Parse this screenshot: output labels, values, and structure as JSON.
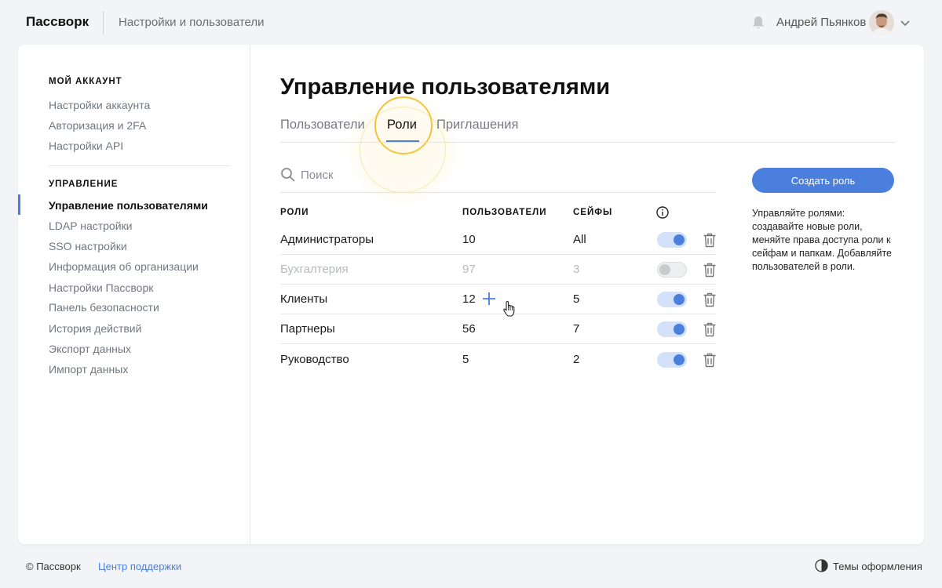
{
  "header": {
    "brand": "Пассворк",
    "breadcrumb": "Настройки и пользователи",
    "user_name": "Андрей Пьянков"
  },
  "sidebar": {
    "account_section": {
      "title": "МОЙ АККАУНТ",
      "items": [
        "Настройки аккаунта",
        "Авторизация и 2FA",
        "Настройки API"
      ]
    },
    "manage_section": {
      "title": "УПРАВЛЕНИЕ",
      "items": [
        "Управление пользователями",
        "LDAP настройки",
        "SSO настройки",
        "Информация об организации",
        "Настройки Пассворк",
        "Панель безопасности",
        "История действий",
        "Экспорт данных",
        "Импорт данных"
      ],
      "active_index": 0
    }
  },
  "main": {
    "title": "Управление пользователями",
    "tabs": [
      "Пользователи",
      "Роли",
      "Приглашения"
    ],
    "active_tab": 1,
    "search_placeholder": "Поиск",
    "columns": {
      "roles": "РОЛИ",
      "users": "ПОЛЬЗОВАТЕЛИ",
      "safes": "СЕЙФЫ"
    },
    "rows": [
      {
        "role": "Администраторы",
        "users": "10",
        "safes": "All",
        "enabled": true
      },
      {
        "role": "Бухгалтерия",
        "users": "97",
        "safes": "3",
        "enabled": false
      },
      {
        "role": "Клиенты",
        "users": "12",
        "safes": "5",
        "enabled": true
      },
      {
        "role": "Партнеры",
        "users": "56",
        "safes": "7",
        "enabled": true
      },
      {
        "role": "Руководство",
        "users": "5",
        "safes": "2",
        "enabled": true
      }
    ],
    "create_button": "Создать роль",
    "help_text": "Управляйте ролями: создавайте новые роли, меняйте права доступа роли к сейфам и папкам. Добавляйте пользователей в роли."
  },
  "footer": {
    "copyright": "© Пассворк",
    "support": "Центр поддержки",
    "themes": "Темы оформления"
  },
  "colors": {
    "accent": "#4a7fde",
    "halo": "#f2c53d",
    "background": "#f3f4f7"
  }
}
